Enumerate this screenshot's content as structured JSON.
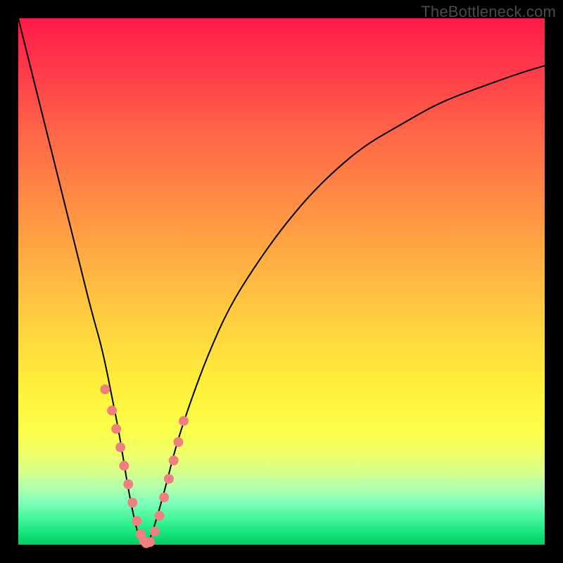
{
  "watermark": "TheBottleneck.com",
  "colors": {
    "marker": "#f08080",
    "curve": "#000000",
    "frame": "#000000"
  },
  "chart_data": {
    "type": "line",
    "title": "",
    "xlabel": "",
    "ylabel": "",
    "xlim": [
      0,
      100
    ],
    "ylim": [
      0,
      100
    ],
    "grid": false,
    "legend": false,
    "notes": "Axis values are positional estimates (0–100 normalized to the plot area). No numeric tick labels are present in the image.",
    "series": [
      {
        "name": "bottleneck-curve",
        "x": [
          0,
          2,
          4,
          6,
          8,
          10,
          12,
          14,
          16,
          18,
          19,
          20,
          21,
          22,
          23,
          24,
          25,
          26,
          28,
          30,
          33,
          36,
          40,
          45,
          50,
          55,
          60,
          66,
          73,
          80,
          88,
          95,
          100
        ],
        "y": [
          100,
          92,
          84,
          76,
          68,
          60,
          52,
          44,
          37,
          27,
          22,
          16,
          10,
          5,
          1,
          0,
          1,
          4,
          11,
          19,
          28,
          36,
          45,
          53,
          60,
          66,
          71,
          76,
          80,
          84,
          87,
          89.5,
          91
        ]
      }
    ],
    "markers": {
      "name": "highlighted-points",
      "color": "#f08080",
      "approx_radius_px": 7,
      "x": [
        16.5,
        17.8,
        18.6,
        19.4,
        20.1,
        20.9,
        21.7,
        22.5,
        23.2,
        23.8,
        24.3,
        25.0,
        25.9,
        26.8,
        27.7,
        28.6,
        29.5,
        30.4,
        31.4
      ],
      "y": [
        29.5,
        25.5,
        22.0,
        18.5,
        15.0,
        11.5,
        8.0,
        4.5,
        2.0,
        0.8,
        0.3,
        0.5,
        2.5,
        5.5,
        9.0,
        12.5,
        16.0,
        19.5,
        23.5
      ]
    }
  }
}
